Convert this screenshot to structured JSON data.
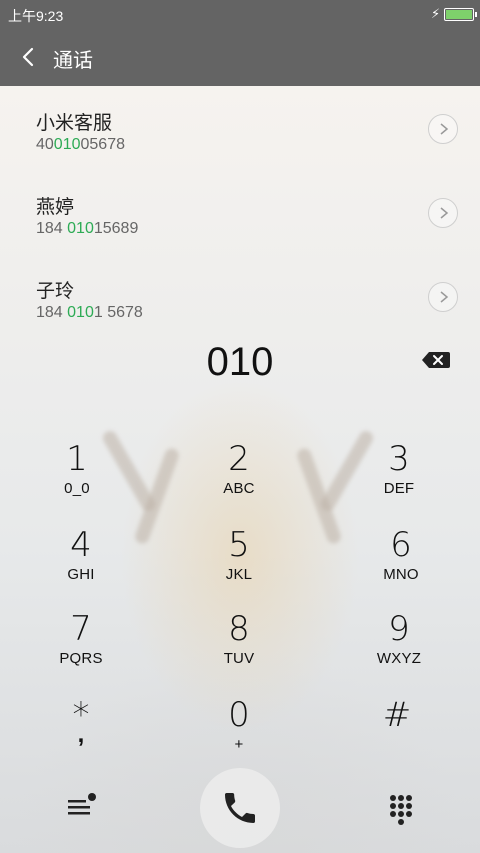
{
  "status_bar": {
    "time": "上午9:23"
  },
  "header": {
    "title": "通话"
  },
  "contacts": [
    {
      "name": "小米客服",
      "num_pre": "40",
      "num_hl": "010",
      "num_post": "05678"
    },
    {
      "name": "燕婷",
      "num_pre": "184 ",
      "num_hl": "010",
      "num_post": "15689"
    },
    {
      "name": "子玲",
      "num_pre": "184 ",
      "num_hl": "010",
      "num_post": "1 5678"
    }
  ],
  "dialed_number": "010",
  "keypad": [
    {
      "digit": "1",
      "letters": "0_0"
    },
    {
      "digit": "2",
      "letters": "ABC"
    },
    {
      "digit": "3",
      "letters": "DEF"
    },
    {
      "digit": "4",
      "letters": "GHI"
    },
    {
      "digit": "5",
      "letters": "JKL"
    },
    {
      "digit": "6",
      "letters": "MNO"
    },
    {
      "digit": "7",
      "letters": "PQRS"
    },
    {
      "digit": "8",
      "letters": "TUV"
    },
    {
      "digit": "9",
      "letters": "WXYZ"
    },
    {
      "digit": "*",
      "letters": ","
    },
    {
      "digit": "0",
      "letters": "+"
    },
    {
      "digit": "#",
      "letters": ""
    }
  ],
  "icons": {
    "back": "chevron-left-icon",
    "contact_detail": "chevron-right-icon",
    "backspace": "backspace-icon",
    "menu": "menu-icon",
    "call": "phone-icon",
    "dialpad": "dialpad-icon"
  },
  "colors": {
    "header_bg": "#646464",
    "highlight": "#2dab55",
    "battery": "#7ed16b"
  }
}
